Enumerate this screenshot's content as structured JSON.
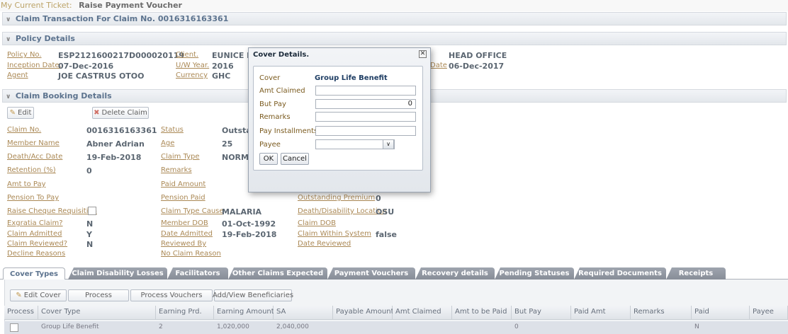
{
  "ticket": {
    "label": "My Current Ticket:",
    "value": "Raise Payment Voucher"
  },
  "claim_bar": "Claim Transaction For Claim No. 0016316163361",
  "policy": {
    "title": "Policy Details",
    "policy_no": {
      "label": "Policy No.",
      "value": "ESP2121600217D000020119"
    },
    "inception": {
      "label": "Inception Date.",
      "value": "07-Dec-2016"
    },
    "agent": {
      "label": "Agent",
      "value": "JOE CASTRUS OTOO"
    },
    "client": {
      "label": "Client.",
      "value": "EUNICE FA"
    },
    "uw_year": {
      "label": "U/W Year.",
      "value": "2016"
    },
    "currency": {
      "label": "Currency",
      "value": "GHC"
    },
    "branch_value": "HEAD OFFICE",
    "date_label": "Date",
    "date_value": "06-Dec-2017"
  },
  "booking": {
    "title": "Claim Booking Details",
    "edit": "Edit",
    "delete": "Delete Claim",
    "claim_no": {
      "label": "Claim No.",
      "value": "0016316163361"
    },
    "member_name": {
      "label": "Member Name",
      "value": "Abner Adrian"
    },
    "death_date": {
      "label": "Death/Acc Date",
      "value": "19-Feb-2018"
    },
    "retention": {
      "label": "Retention (%)",
      "value": "0"
    },
    "amt_to_pay": {
      "label": "Amt to Pay"
    },
    "pension_to_pay": {
      "label": "Pension To Pay"
    },
    "raise_cheque": {
      "label": "Raise Cheque Requisition"
    },
    "exgratia": {
      "label": "Exgratia Claim?",
      "value": "N"
    },
    "claim_admitted": {
      "label": "Claim Admitted",
      "value": "Y"
    },
    "claim_reviewed": {
      "label": "Claim Reviewed?",
      "value": "N"
    },
    "decline_reasons": {
      "label": "Decline Reasons"
    },
    "status": {
      "label": "Status",
      "value": "Outstan"
    },
    "age": {
      "label": "Age",
      "value": "25"
    },
    "claim_type": {
      "label": "Claim Type",
      "value": "NORMA"
    },
    "remarks": {
      "label": "Remarks"
    },
    "paid_amount": {
      "label": "Paid Amount"
    },
    "pension_paid": {
      "label": "Pension Paid"
    },
    "claim_type_cause": {
      "label": "Claim Type Cause",
      "value": "MALARIA"
    },
    "member_dob": {
      "label": "Member DOB",
      "value": "01-Oct-1992"
    },
    "date_admitted": {
      "label": "Date Admitted",
      "value": "19-Feb-2018"
    },
    "reviewed_by": {
      "label": "Reviewed By"
    },
    "no_claim_reason": {
      "label": "No Claim Reason"
    },
    "outstanding_premium": {
      "label": "Outstanding Premium",
      "value": "0"
    },
    "death_location": {
      "label": "Death/Disability Location",
      "value": "OSU"
    },
    "claim_dob": {
      "label": "Claim DOB"
    },
    "claim_within_system": {
      "label": "Claim Within System",
      "value": "false"
    },
    "date_reviewed": {
      "label": "Date Reviewed"
    }
  },
  "tabs": [
    "Cover Types",
    "Claim Disability Losses",
    "Facilitators",
    "Other Claims Expected",
    "Payment Vouchers",
    "Recovery details",
    "Pending Statuses",
    "Required Documents",
    "Receipts"
  ],
  "toolbar": {
    "edit_cover": "Edit Cover",
    "process": "Process",
    "process_vouchers": "Process Vouchers",
    "add_view_beneficiaries": "Add/View Beneficiaries"
  },
  "grid": {
    "columns": [
      "Process",
      "Cover Type",
      "Earning Prd.",
      "Earning Amount",
      "SA",
      "Payable Amount",
      "Amt Claimed",
      "Amt to be Paid",
      "But Pay",
      "Paid Amt",
      "Remarks",
      "Paid",
      "Payee"
    ],
    "row": {
      "cover_type": "Group Life Benefit",
      "earning_prd": "2",
      "earning_amount": "1,020,000",
      "sa": "2,040,000",
      "but_pay": "0",
      "paid": "N"
    }
  },
  "dialog": {
    "title": "Cover Details.",
    "cover_label": "Cover",
    "cover_value": "Group Life Benefit",
    "amt_claimed_label": "Amt Claimed",
    "amt_claimed_value": "",
    "but_pay_label": "But Pay",
    "but_pay_value": "0",
    "remarks_label": "Remarks",
    "installments_label": "Pay Installments",
    "payee_label": "Payee",
    "ok": "OK",
    "cancel": "Cancel"
  },
  "colors": {
    "link_label": "#8a5a12",
    "value_text": "#1b2a3a",
    "header_text": "#1e3d63",
    "tab_inactive": "#6a7280"
  }
}
